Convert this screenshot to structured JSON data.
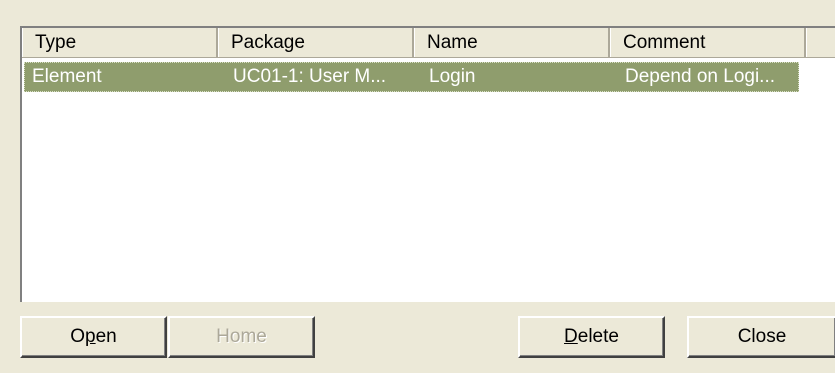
{
  "list": {
    "columns": [
      "Type",
      "Package",
      "Name",
      "Comment",
      ""
    ],
    "rows": [
      {
        "type": "Element",
        "package": "UC01-1: User M...",
        "name": "Login",
        "comment": "Depend on Logi..."
      }
    ],
    "selected_row_color": "#8f9d6d"
  },
  "buttons": {
    "open": {
      "pre": "O",
      "mnemonic": "p",
      "post": "en",
      "enabled": true
    },
    "home": {
      "label": "Home",
      "enabled": false
    },
    "delete": {
      "pre": "",
      "mnemonic": "D",
      "post": "elete",
      "enabled": true
    },
    "close": {
      "label": "Close",
      "enabled": true
    }
  }
}
